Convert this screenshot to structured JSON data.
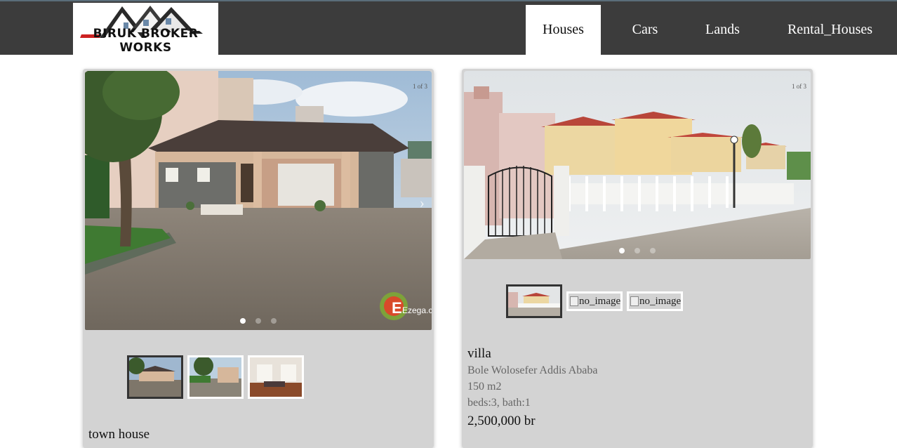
{
  "brand": {
    "name": "BIRUK BROKER WORKS"
  },
  "nav": {
    "items": [
      {
        "label": "Houses",
        "active": true
      },
      {
        "label": "Cars",
        "active": false
      },
      {
        "label": "Lands",
        "active": false
      },
      {
        "label": "Rental_Houses",
        "active": false
      }
    ]
  },
  "listings": [
    {
      "counter": "1 of 3",
      "watermark": "Ezega.com",
      "title": "town house",
      "thumbnails": [
        "photo",
        "photo",
        "photo"
      ],
      "selected_thumbnail": 1,
      "slide_count": 3,
      "active_slide": 1
    },
    {
      "counter": "1 of 3",
      "title": "villa",
      "location": "Bole Wolosefer Addis Ababa",
      "area": "150 m2",
      "rooms": "beds:3, bath:1",
      "price": "2,500,000 br",
      "thumbnails": [
        "photo",
        "no_image",
        "no_image"
      ],
      "broken_alt": "no_image",
      "selected_thumbnail": 1,
      "slide_count": 3,
      "active_slide": 1
    }
  ]
}
